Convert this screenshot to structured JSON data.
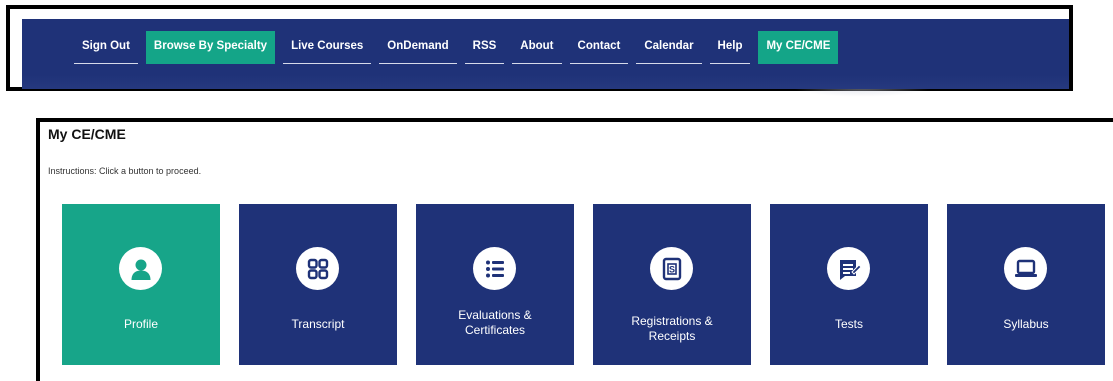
{
  "nav": {
    "items": [
      {
        "label": "Sign Out"
      },
      {
        "label": "Browse By Specialty",
        "active": true
      },
      {
        "label": "Live Courses"
      },
      {
        "label": "OnDemand"
      },
      {
        "label": "RSS"
      },
      {
        "label": "About"
      },
      {
        "label": "Contact"
      },
      {
        "label": "Calendar"
      },
      {
        "label": "Help"
      },
      {
        "label": "My CE/CME",
        "active": true
      }
    ]
  },
  "main": {
    "title": "My CE/CME",
    "instructions": "Instructions: Click a button to proceed.",
    "tiles": [
      {
        "label": "Profile",
        "icon": "user-icon",
        "active": true
      },
      {
        "label": "Transcript",
        "icon": "grid-icon"
      },
      {
        "label": "Evaluations &\nCertificates",
        "icon": "list-icon"
      },
      {
        "label": "Registrations &\nReceipts",
        "icon": "receipt-icon"
      },
      {
        "label": "Tests",
        "icon": "document-icon"
      },
      {
        "label": "Syllabus",
        "icon": "laptop-icon"
      }
    ]
  },
  "colors": {
    "nav_bg": "#1f3278",
    "accent": "#17a589",
    "tile_bg": "#1f3278"
  }
}
